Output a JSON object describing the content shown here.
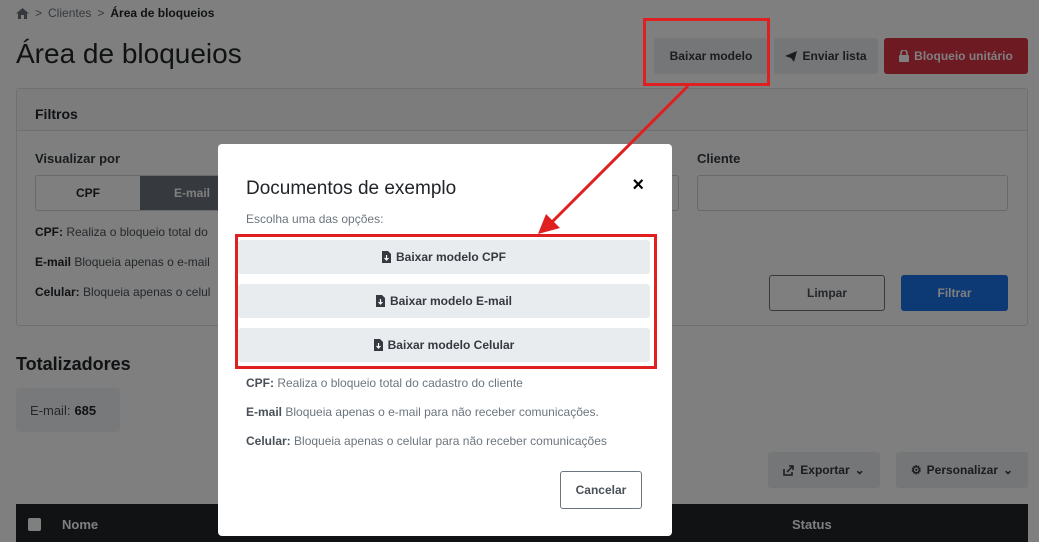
{
  "breadcrumb": {
    "home_icon": "home-icon",
    "parent": "Clientes",
    "current": "Área de bloqueios"
  },
  "page": {
    "title": "Área de bloqueios"
  },
  "header_buttons": {
    "download_template": "Baixar modelo",
    "send_list": "Enviar lista",
    "single_block": "Bloqueio unitário"
  },
  "filters": {
    "title": "Filtros",
    "view_by_label": "Visualizar por",
    "view_by_options": [
      "CPF",
      "E-mail"
    ],
    "hints": [
      {
        "key": "CPF:",
        "text": " Realiza o bloqueio total do"
      },
      {
        "key": "E-mail",
        "text": " Bloqueia apenas o e-mail"
      },
      {
        "key": "Celular:",
        "text": " Bloqueia apenas o celul"
      }
    ],
    "client_label": "Cliente",
    "clear_label": "Limpar",
    "filter_label": "Filtrar"
  },
  "totals": {
    "title": "Totalizadores",
    "email_label": "E-mail:",
    "email_count": "685"
  },
  "toolbar": {
    "export_label": "Exportar",
    "customize_label": "Personalizar"
  },
  "table": {
    "col_name": "Nome",
    "col_status": "Status"
  },
  "modal": {
    "title": "Documentos de exemplo",
    "close": "×",
    "subtitle": "Escolha uma das opções:",
    "options": [
      "Baixar modelo CPF",
      "Baixar modelo E-mail",
      "Baixar modelo Celular"
    ],
    "hints": [
      {
        "key": "CPF:",
        "text": " Realiza o bloqueio total do cadastro do cliente"
      },
      {
        "key": "E-mail",
        "text": " Bloqueia apenas o e-mail para não receber comunicações."
      },
      {
        "key": "Celular:",
        "text": " Bloqueia apenas o celular para não receber comunicações"
      }
    ],
    "cancel_label": "Cancelar"
  },
  "colors": {
    "accent_red": "#dc3545",
    "primary_blue": "#1a73e8",
    "annotation_red": "#e02020"
  }
}
